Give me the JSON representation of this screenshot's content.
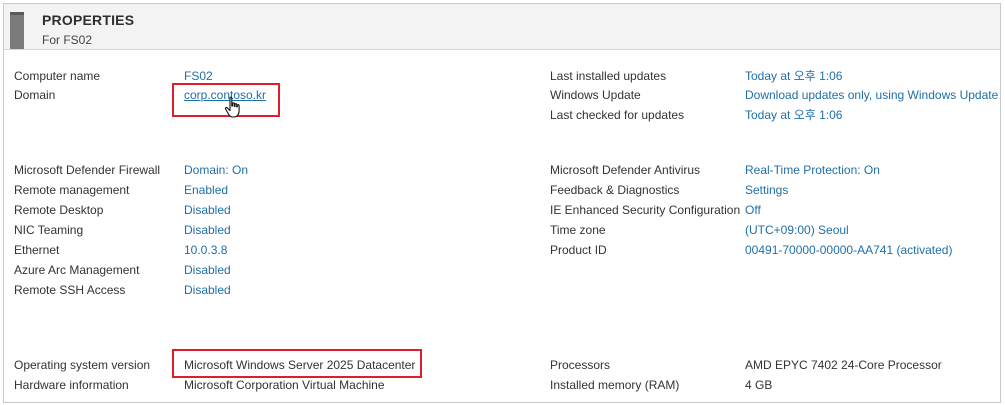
{
  "header": {
    "title": "PROPERTIES",
    "subtitle": "For FS02"
  },
  "left_top": [
    {
      "label": "Computer name",
      "value": "FS02"
    },
    {
      "label": "Domain",
      "value": "corp.contoso.kr"
    }
  ],
  "right_top": [
    {
      "label": "Last installed updates",
      "value": "Today at 오후 1:06"
    },
    {
      "label": "Windows Update",
      "value": "Download updates only, using Windows Update"
    },
    {
      "label": "Last checked for updates",
      "value": "Today at 오후 1:06"
    }
  ],
  "left_mid": [
    {
      "label": "Microsoft Defender Firewall",
      "value": "Domain: On"
    },
    {
      "label": "Remote management",
      "value": "Enabled"
    },
    {
      "label": "Remote Desktop",
      "value": "Disabled"
    },
    {
      "label": "NIC Teaming",
      "value": "Disabled"
    },
    {
      "label": "Ethernet",
      "value": "10.0.3.8"
    },
    {
      "label": "Azure Arc Management",
      "value": "Disabled"
    },
    {
      "label": "Remote SSH Access",
      "value": "Disabled"
    }
  ],
  "right_mid": [
    {
      "label": "Microsoft Defender Antivirus",
      "value": "Real-Time Protection: On"
    },
    {
      "label": "Feedback & Diagnostics",
      "value": "Settings"
    },
    {
      "label": "IE Enhanced Security Configuration",
      "value": "Off"
    },
    {
      "label": "Time zone",
      "value": "(UTC+09:00) Seoul"
    },
    {
      "label": "Product ID",
      "value": "00491-70000-00000-AA741 (activated)"
    }
  ],
  "left_bottom": [
    {
      "label": "Operating system version",
      "value": "Microsoft Windows Server 2025 Datacenter"
    },
    {
      "label": "Hardware information",
      "value": "Microsoft Corporation Virtual Machine"
    }
  ],
  "right_bottom": [
    {
      "label": "Processors",
      "value": "AMD EPYC 7402 24-Core Processor"
    },
    {
      "label": "Installed memory (RAM)",
      "value": "4 GB"
    }
  ],
  "colors": {
    "link": "#1f6fa8",
    "highlight": "#e01e2b"
  },
  "icons": {
    "header": "server-icon",
    "cursor": "hand-pointer-icon"
  }
}
